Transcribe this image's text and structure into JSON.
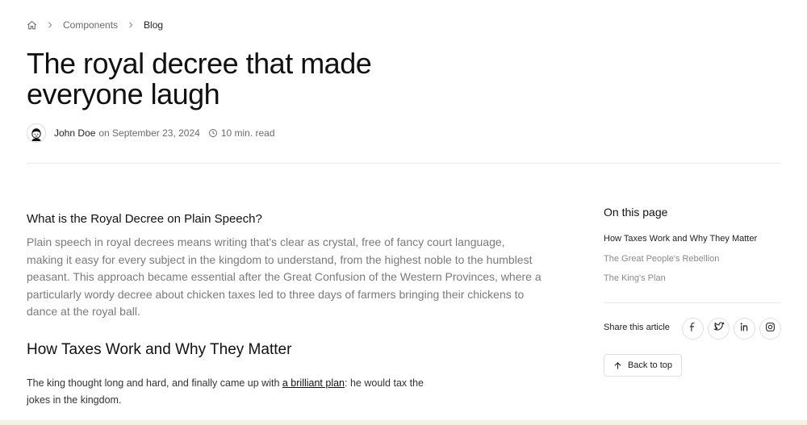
{
  "breadcrumb": {
    "home_icon": "home-icon",
    "items": [
      "Components",
      "Blog"
    ]
  },
  "article": {
    "title": "The royal decree that made everyone laugh",
    "author": "John Doe",
    "date_prefix": "on September 23, 2024",
    "read_time": "10 min. read",
    "section1_heading": "What is the Royal Decree on Plain Speech?",
    "section1_text": "Plain speech in royal decrees means writing that's clear as crystal, free of fancy court language, making it easy for every subject in the kingdom to understand, from the highest noble to the humblest peasant. This approach became essential after the Great Confusion of the Western Provinces, where a particularly wordy decree about chicken taxes led to three days of farmers bringing their chickens to dance at the royal ball.",
    "section2_heading": "How Taxes Work and Why They Matter",
    "section2_text_before": "The king thought long and hard, and finally came up with ",
    "section2_link": "a brilliant plan",
    "section2_text_after": ": he would tax the jokes in the kingdom."
  },
  "sidebar": {
    "toc_title": "On this page",
    "toc_items": [
      "How Taxes Work and Why They Matter",
      "The Great People's Rebellion",
      "The King's Plan"
    ],
    "share_label": "Share this article",
    "share_icons": [
      "facebook-icon",
      "twitter-icon",
      "linkedin-icon",
      "instagram-icon"
    ],
    "back_to_top": "Back to top"
  },
  "colors": {
    "text_primary": "#111111",
    "text_muted": "#7a7a7a",
    "border": "#e8e8e8",
    "bottom_strip": "#f4f1de"
  }
}
